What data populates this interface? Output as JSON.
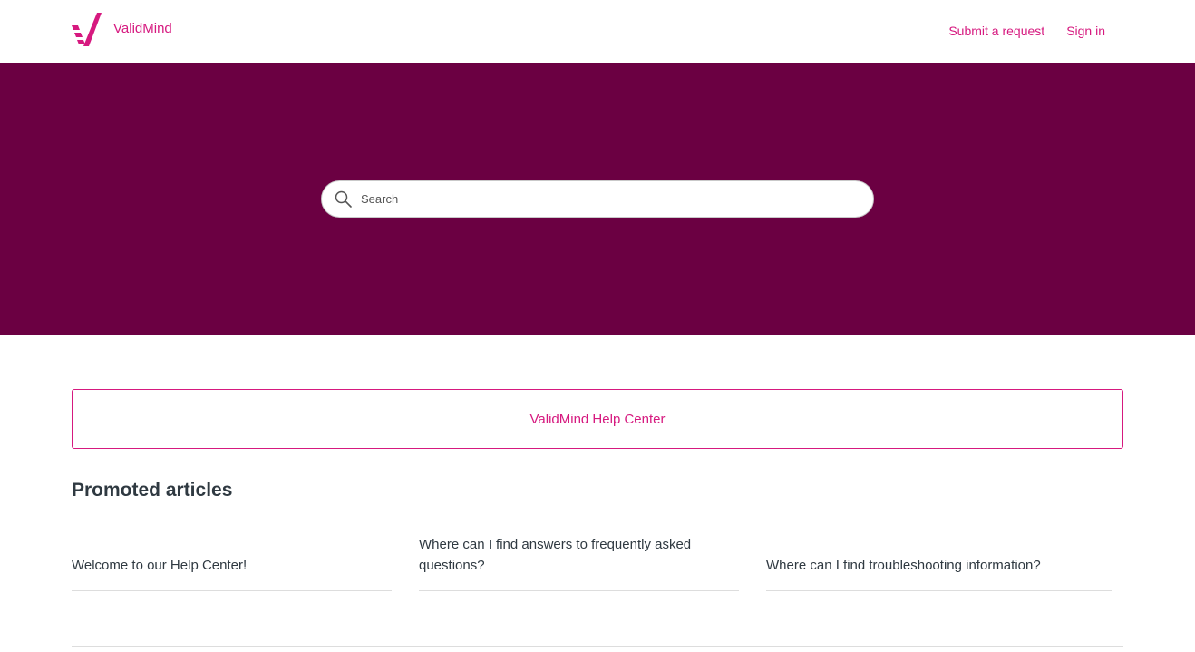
{
  "header": {
    "brand_name": "ValidMind",
    "nav": {
      "submit_request": "Submit a request",
      "sign_in": "Sign in"
    }
  },
  "hero": {
    "search": {
      "placeholder": "Search",
      "value": "",
      "icon": "search-icon"
    }
  },
  "help_center_link": "ValidMind Help Center",
  "promoted": {
    "title": "Promoted articles",
    "articles": [
      {
        "title": "Welcome to our Help Center!"
      },
      {
        "title": "Where can I find answers to frequently asked questions?"
      },
      {
        "title": "Where can I find troubleshooting information?"
      }
    ]
  },
  "colors": {
    "brand": "#d6197f",
    "hero_background": "#6b0042",
    "text": "#2f3941"
  }
}
